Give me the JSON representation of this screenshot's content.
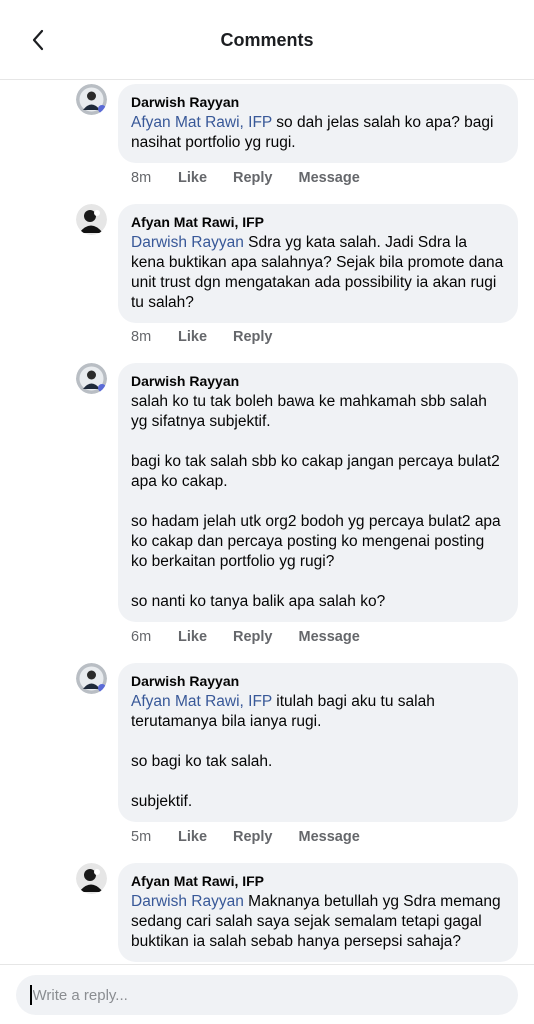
{
  "header": {
    "title": "Comments",
    "back_icon": "chevron-left-icon"
  },
  "comments": [
    {
      "author": "Darwish Rayyan",
      "avatar": "darwish-avatar",
      "mention": "Afyan Mat Rawi, IFP",
      "paragraphs": [
        " so dah jelas salah ko apa? bagi nasihat portfolio yg rugi."
      ],
      "time": "8m",
      "actions": [
        "Like",
        "Reply",
        "Message"
      ]
    },
    {
      "author": "Afyan Mat Rawi, IFP",
      "avatar": "afyan-avatar",
      "mention": "Darwish Rayyan",
      "paragraphs": [
        " Sdra yg kata salah. Jadi Sdra la kena buktikan apa salahnya? Sejak bila promote dana unit trust dgn mengatakan ada possibility ia akan rugi tu salah?"
      ],
      "time": "8m",
      "actions": [
        "Like",
        "Reply"
      ]
    },
    {
      "author": "Darwish Rayyan",
      "avatar": "darwish-avatar",
      "mention": "",
      "paragraphs": [
        "salah ko tu tak boleh bawa ke mahkamah sbb salah yg sifatnya subjektif.",
        "bagi ko tak salah sbb ko cakap jangan percaya bulat2 apa ko cakap.",
        "so hadam jelah utk org2 bodoh yg percaya bulat2 apa ko cakap dan percaya posting ko mengenai posting ko berkaitan portfolio yg rugi?",
        "so nanti ko tanya balik apa salah ko?"
      ],
      "time": "6m",
      "actions": [
        "Like",
        "Reply",
        "Message"
      ]
    },
    {
      "author": "Darwish Rayyan",
      "avatar": "darwish-avatar",
      "mention": "Afyan Mat Rawi, IFP",
      "paragraphs": [
        " itulah bagi aku tu salah terutamanya bila ianya rugi.",
        "so bagi ko tak salah.",
        "subjektif."
      ],
      "time": "5m",
      "actions": [
        "Like",
        "Reply",
        "Message"
      ]
    },
    {
      "author": "Afyan Mat Rawi, IFP",
      "avatar": "afyan-avatar",
      "mention": "Darwish Rayyan",
      "paragraphs": [
        " Maknanya betullah yg Sdra memang sedang cari salah saya sejak semalam tetapi gagal buktikan ia salah sebab hanya persepsi sahaja?"
      ],
      "time": "",
      "actions": []
    }
  ],
  "composer": {
    "placeholder": "Write a reply..."
  },
  "colors": {
    "mention": "#385898",
    "bubble": "#f0f2f5",
    "meta": "#65676b"
  }
}
